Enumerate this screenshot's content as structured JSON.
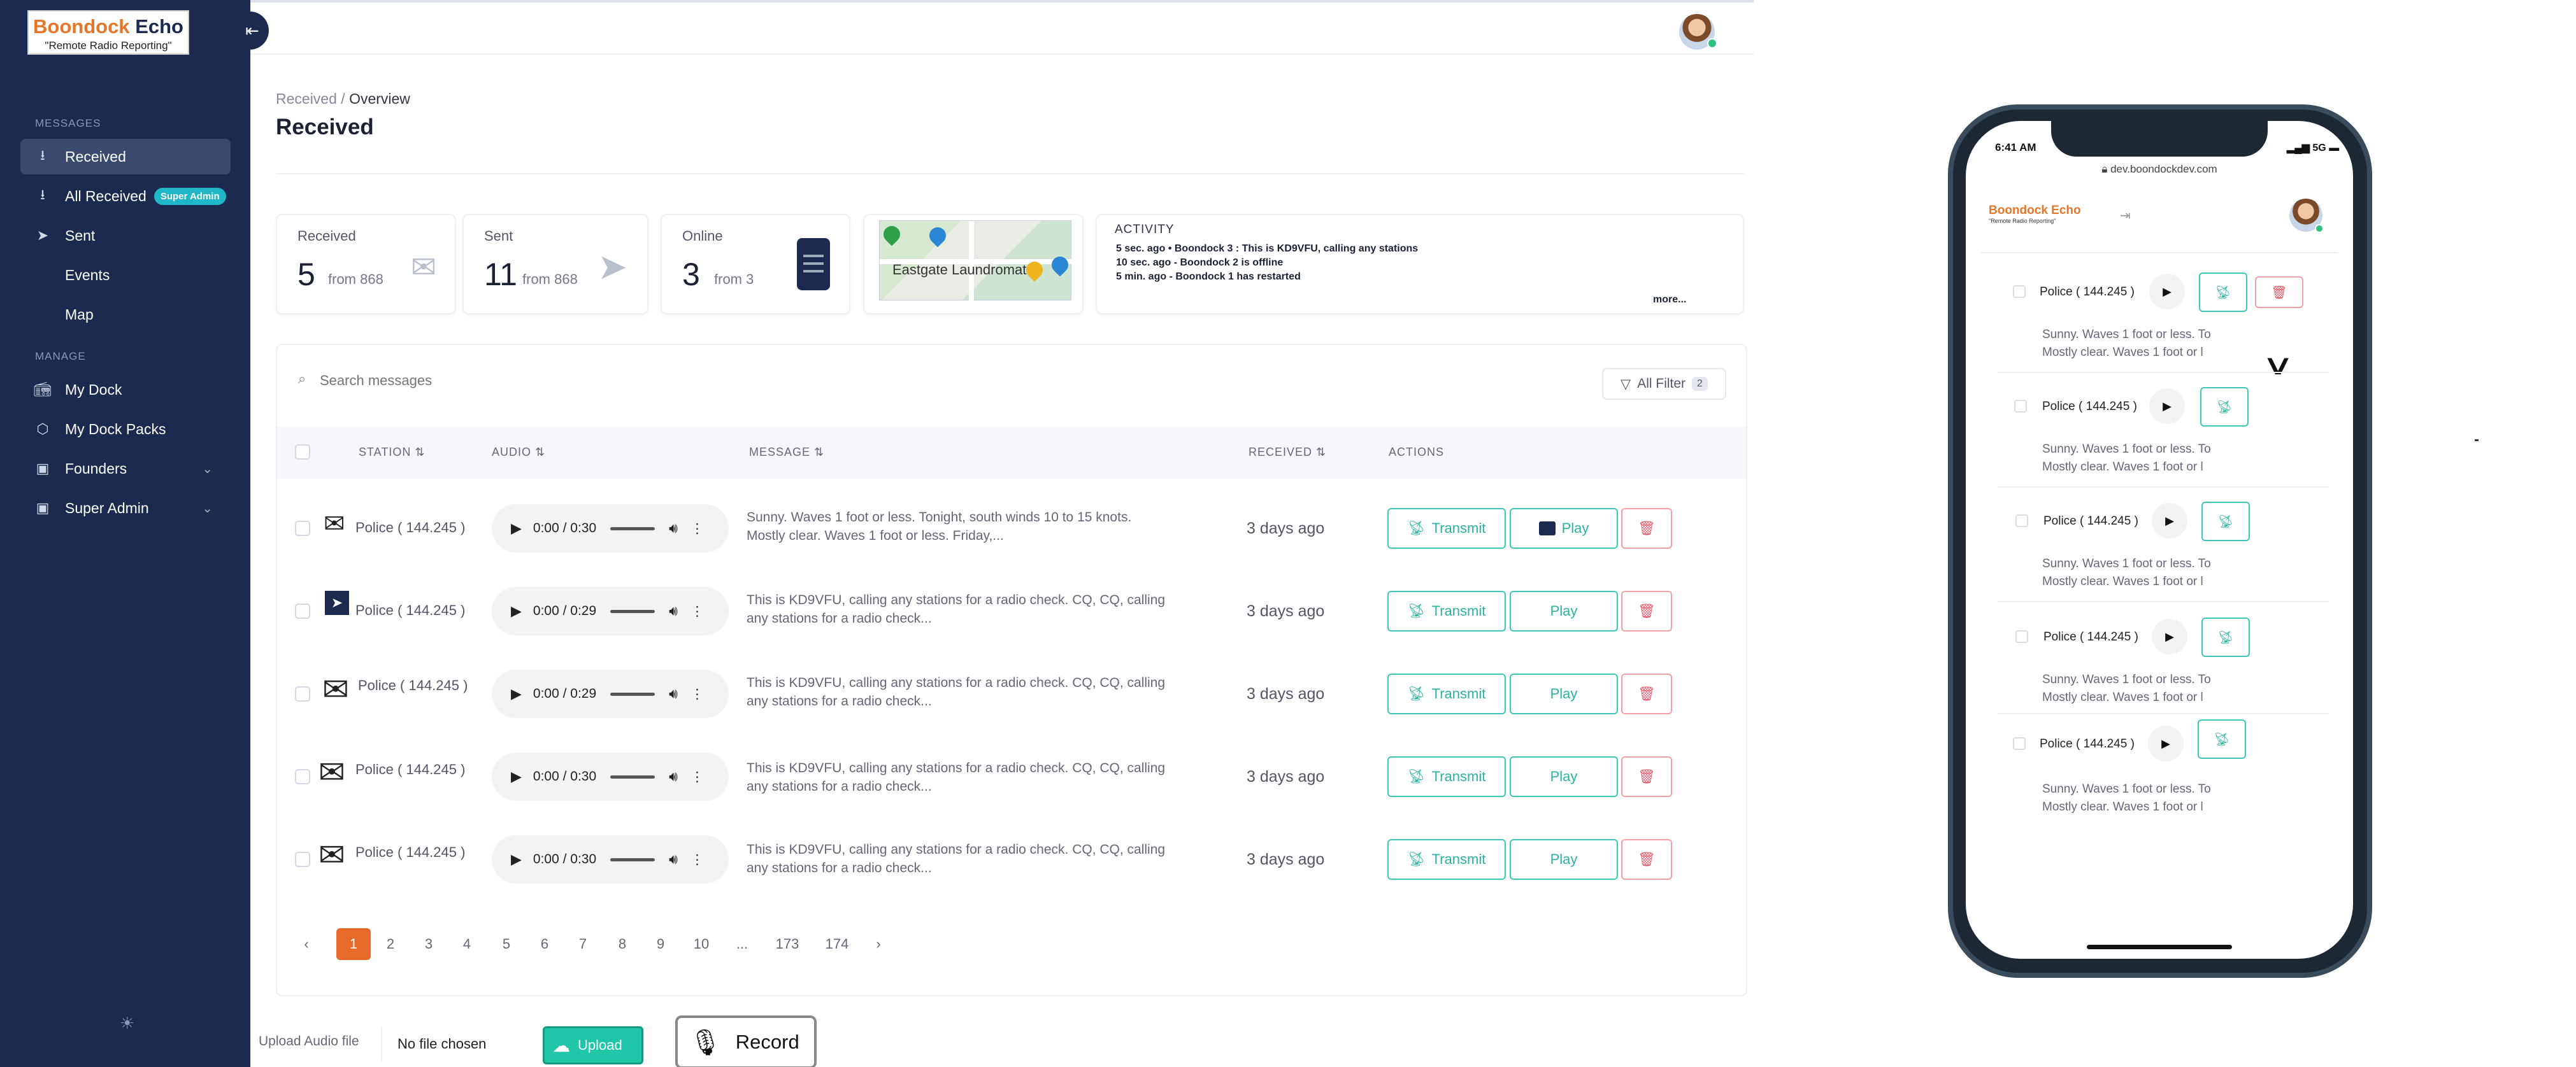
{
  "logo": {
    "brand_orange": "Boondock",
    "brand_dark": "Echo",
    "tagline": "\"Remote Radio Reporting\""
  },
  "sidebar": {
    "messages_section": "MESSAGES",
    "manage_section": "MANAGE",
    "items": [
      {
        "label": "Received",
        "icon": "download-icon"
      },
      {
        "label": "All Received",
        "icon": "download-icon",
        "badge": "Super Admin"
      },
      {
        "label": "Sent",
        "icon": "send-icon"
      },
      {
        "label": "Events",
        "icon": ""
      },
      {
        "label": "Map",
        "icon": ""
      },
      {
        "label": "My Dock",
        "icon": "radio-icon"
      },
      {
        "label": "My Dock Packs",
        "icon": "box-icon"
      },
      {
        "label": "Founders",
        "icon": "id-card-icon"
      },
      {
        "label": "Super Admin",
        "icon": "id-card-icon"
      }
    ]
  },
  "breadcrumb": {
    "parent": "Received",
    "sep": "/",
    "current": "Overview"
  },
  "page_title": "Received",
  "stats": {
    "received": {
      "label": "Received",
      "value": "5",
      "from": "from 868"
    },
    "sent": {
      "label": "Sent",
      "value": "11",
      "from": "from 868"
    },
    "online": {
      "label": "Online",
      "value": "3",
      "from": "from 3"
    }
  },
  "map": {
    "place": "Eastgate Laundromat"
  },
  "activity": {
    "title": "ACTIVITY",
    "items": [
      "5 sec. ago  •   Boondock 3 : This is KD9VFU, calling any stations",
      "10 sec. ago - Boondock 2 is offline",
      "5 min. ago - Boondock 1 has restarted"
    ],
    "more": "more..."
  },
  "search": {
    "placeholder": "Search messages"
  },
  "filter": {
    "label": "All Filter",
    "count": "2"
  },
  "columns": {
    "station": "STATION",
    "audio": "AUDIO",
    "message": "MESSAGE",
    "received": "RECEIVED",
    "actions": "ACTIONS"
  },
  "rows": [
    {
      "station": "Police  ( 144.245 )",
      "time": "0:00 / 0:30",
      "msg1": "Sunny. Waves 1 foot or less. Tonight, south winds 10 to 15 knots.",
      "msg2": "Mostly clear. Waves 1 foot or less. Friday,...",
      "received": "3 days ago"
    },
    {
      "station": "Police  ( 144.245 )",
      "time": "0:00 / 0:29",
      "msg1": "This is KD9VFU, calling any stations for a radio check. CQ, CQ, calling",
      "msg2": "any stations for a radio check...",
      "received": "3 days ago"
    },
    {
      "station": "Police  ( 144.245 )",
      "time": "0:00 / 0:29",
      "msg1": "This is KD9VFU, calling any stations for a radio check. CQ, CQ, calling",
      "msg2": "any stations for a radio check...",
      "received": "3 days ago"
    },
    {
      "station": "Police  ( 144.245 )",
      "time": "0:00 / 0:30",
      "msg1": "This is KD9VFU, calling any stations for a radio check. CQ, CQ, calling",
      "msg2": "any stations for a radio check...",
      "received": "3 days ago"
    },
    {
      "station": "Police  ( 144.245 )",
      "time": "0:00 / 0:30",
      "msg1": "This is KD9VFU, calling any stations for a radio check. CQ, CQ, calling",
      "msg2": "any stations for a radio check...",
      "received": "3 days ago"
    }
  ],
  "actions": {
    "transmit": "Transmit",
    "play": "Play"
  },
  "pagination": {
    "prev": "‹",
    "next": "›",
    "pages": [
      "1",
      "2",
      "3",
      "4",
      "5",
      "6",
      "7",
      "8",
      "9",
      "10",
      "...",
      "173",
      "174"
    ],
    "current": "1"
  },
  "upload": {
    "label": "Upload Audio file",
    "file_status": "No file chosen",
    "button": "Upload"
  },
  "record": {
    "label": "Record"
  },
  "phone": {
    "time": "6:41 AM",
    "status": "5G",
    "url": "dev.boondockdev.com",
    "logo": "Boondock Echo",
    "tagline": "\"Remote Radio Reporting\"",
    "rows": [
      {
        "station": "Police ( 144.245 )",
        "msg1": "Sunny. Waves 1 foot or less. To",
        "msg2": "Mostly clear. Waves 1 foot or l"
      },
      {
        "station": "Police ( 144.245 )",
        "msg1": "Sunny. Waves 1 foot or less. To",
        "msg2": "Mostly clear. Waves 1 foot or l"
      },
      {
        "station": "Police ( 144.245 )",
        "msg1": "Sunny. Waves 1 foot or less. To",
        "msg2": "Mostly clear. Waves 1 foot or l"
      },
      {
        "station": "Police ( 144.245 )",
        "msg1": "Sunny. Waves 1 foot or less. To",
        "msg2": "Mostly clear. Waves 1 foot or l"
      },
      {
        "station": "Police ( 144.245 )",
        "msg1": "Sunny. Waves 1 foot or less. To",
        "msg2": "Mostly clear. Waves 1 foot or l"
      }
    ]
  },
  "colors": {
    "sidebar": "#1b2a4e",
    "accent_teal": "#2bb3a0",
    "accent_orange": "#e86a2a",
    "danger": "#e05a6a"
  }
}
